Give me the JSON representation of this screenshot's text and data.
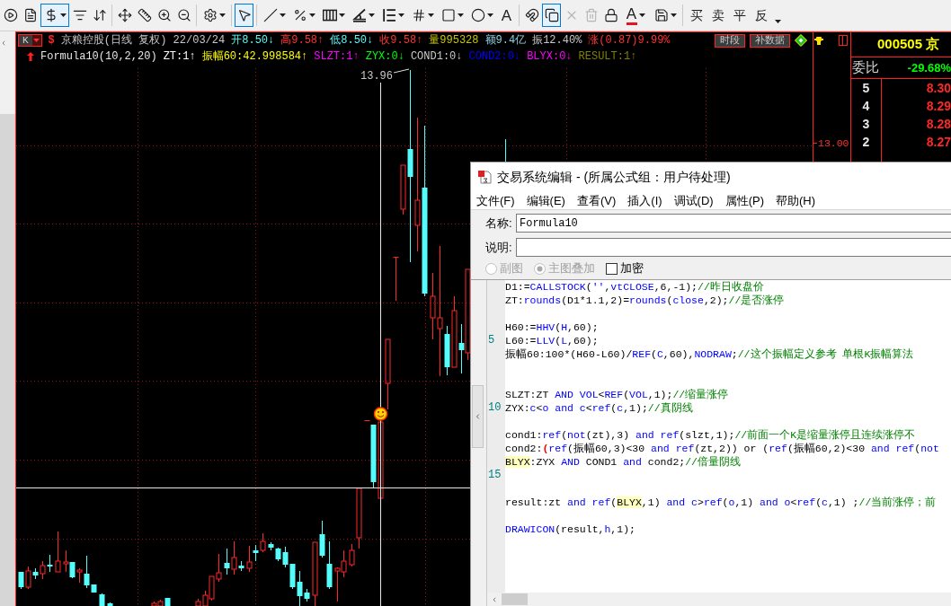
{
  "toolbar": {
    "groups": [
      {
        "tools": [
          {
            "kind": "icon",
            "selected": false,
            "disabled": false,
            "dropdown": false
          },
          {
            "kind": "icon",
            "selected": false,
            "disabled": false,
            "dropdown": false
          },
          {
            "kind": "icon",
            "selected": true,
            "disabled": false,
            "dropdown": true
          },
          {
            "kind": "icon",
            "selected": false,
            "disabled": false,
            "dropdown": false
          },
          {
            "kind": "icon",
            "selected": false,
            "disabled": false,
            "dropdown": false
          }
        ]
      },
      {
        "tools": [
          {
            "kind": "icon",
            "selected": false,
            "disabled": false,
            "dropdown": false
          },
          {
            "kind": "icon",
            "selected": false,
            "disabled": false,
            "dropdown": false
          },
          {
            "kind": "icon",
            "selected": false,
            "disabled": false,
            "dropdown": false
          },
          {
            "kind": "icon",
            "selected": false,
            "disabled": false,
            "dropdown": false
          }
        ]
      },
      {
        "tools": [
          {
            "kind": "icon",
            "selected": false,
            "disabled": false,
            "dropdown": true
          }
        ]
      },
      {
        "tools": [
          {
            "kind": "icon",
            "selected": true,
            "disabled": false,
            "dropdown": false
          }
        ]
      },
      {
        "tools": [
          {
            "kind": "icon",
            "selected": false,
            "disabled": false,
            "dropdown": true
          },
          {
            "kind": "icon",
            "selected": false,
            "disabled": false,
            "dropdown": true
          },
          {
            "kind": "icon",
            "selected": false,
            "disabled": false,
            "dropdown": true
          },
          {
            "kind": "icon",
            "selected": false,
            "disabled": false,
            "dropdown": true
          },
          {
            "kind": "icon",
            "selected": false,
            "disabled": false,
            "dropdown": true
          },
          {
            "kind": "icon",
            "selected": false,
            "disabled": false,
            "dropdown": true
          },
          {
            "kind": "icon",
            "selected": false,
            "disabled": false,
            "dropdown": true
          },
          {
            "kind": "icon",
            "selected": false,
            "disabled": false,
            "dropdown": true
          },
          {
            "kind": "text",
            "label": "A",
            "selected": false,
            "disabled": false,
            "dropdown": false
          }
        ]
      },
      {
        "tools": [
          {
            "kind": "icon",
            "selected": false,
            "disabled": false,
            "dropdown": false
          },
          {
            "kind": "icon",
            "selected": true,
            "disabled": false,
            "dropdown": false
          },
          {
            "kind": "icon",
            "selected": false,
            "disabled": true,
            "dropdown": false
          },
          {
            "kind": "icon",
            "selected": false,
            "disabled": true,
            "dropdown": false
          },
          {
            "kind": "icon",
            "selected": false,
            "disabled": false,
            "dropdown": false
          },
          {
            "kind": "font-color",
            "label": "A",
            "selected": false,
            "disabled": false,
            "dropdown": true
          },
          {
            "kind": "icon",
            "selected": false,
            "disabled": false,
            "dropdown": true
          }
        ]
      },
      {
        "tools": [
          {
            "kind": "trade",
            "label": "买",
            "selected": false,
            "disabled": false,
            "dropdown": false
          },
          {
            "kind": "trade",
            "label": "卖",
            "selected": false,
            "disabled": false,
            "dropdown": false
          },
          {
            "kind": "trade",
            "label": "平",
            "selected": false,
            "disabled": false,
            "dropdown": false
          },
          {
            "kind": "trade",
            "label": "反",
            "selected": false,
            "disabled": false,
            "dropdown": false
          },
          {
            "kind": "more",
            "selected": false,
            "disabled": false,
            "dropdown": true
          }
        ]
      }
    ]
  },
  "chart": {
    "period": "K",
    "symbol_mark": "$",
    "quote": [
      {
        "text": "京粮控股(日线 复权) 22/03/24",
        "color": "#c8c8c8"
      },
      {
        "text": "开8.50↓",
        "color": "#54fcfc"
      },
      {
        "text": "高9.58↑",
        "color": "#ff3232"
      },
      {
        "text": "低8.50↓",
        "color": "#54fcfc"
      },
      {
        "text": "收9.58↑",
        "color": "#ff3232"
      },
      {
        "text": "量995328",
        "color": "#c8c800"
      },
      {
        "text": "额9.4亿",
        "color": "#8cd2e6"
      },
      {
        "text": "振12.40%",
        "color": "#c8c8c8"
      },
      {
        "text": "涨(0.87)9.99%",
        "color": "#ff3232"
      }
    ],
    "buttons": [
      "时段",
      "补数据"
    ],
    "indicators": [
      {
        "text": "Formula10(10,2,20)",
        "color": "#e6e6e6"
      },
      {
        "text": "ZT:1↑",
        "color": "#ffffff"
      },
      {
        "text": "振幅60:42.998584↑",
        "color": "#ffff00"
      },
      {
        "text": "SLZT:1↑",
        "color": "#ff00ff"
      },
      {
        "text": "ZYX:0↓",
        "color": "#00ff00"
      },
      {
        "text": "COND1:0↓",
        "color": "#c8c8c8"
      },
      {
        "text": "COND2:0↓",
        "color": "#0000ff"
      },
      {
        "text": "BLYX:0↓",
        "color": "#ff00ff"
      },
      {
        "text": "RESULT:1↑",
        "color": "#808000"
      }
    ],
    "high_label": "13.96",
    "axis_label": "13.00"
  },
  "quote_panel": {
    "title": "000505 京",
    "ratio_label": "委比",
    "ratio_value": "-29.68%",
    "asks": [
      {
        "rank": "5",
        "price": "8.30"
      },
      {
        "rank": "4",
        "price": "8.29"
      },
      {
        "rank": "3",
        "price": "8.28"
      },
      {
        "rank": "2",
        "price": "8.27"
      }
    ]
  },
  "editor": {
    "title": "交易系统编辑 - (所属公式组：用户待处理)",
    "menu": [
      "文件(F)",
      "编辑(E)",
      "查看(V)",
      "插入(I)",
      "调试(D)",
      "属性(P)",
      "帮助(H)"
    ],
    "name_label": "名称:",
    "name_value": "Formula10",
    "description_label": "说明:",
    "chart_types": [
      {
        "label": "副图",
        "selected": false,
        "disabled": true
      },
      {
        "label": "主图叠加",
        "selected": true,
        "disabled": true
      }
    ],
    "encrypt": {
      "label": "加密",
      "checked": false
    },
    "code_lines": [
      {
        "kind": "code",
        "tokens": [
          {
            "text": "D1:=",
            "kind": "plain"
          },
          {
            "text": "CALLSTOCK",
            "kind": "keyword"
          },
          {
            "text": "(",
            "kind": "plain"
          },
          {
            "text": "''",
            "kind": "keyword"
          },
          {
            "text": ",",
            "kind": "plain"
          },
          {
            "text": "vtCLOSE",
            "kind": "keyword"
          },
          {
            "text": ",6,-1);",
            "kind": "plain"
          },
          {
            "text": "//昨日收盘价",
            "kind": "comment"
          }
        ]
      },
      {
        "kind": "code",
        "tokens": [
          {
            "text": "ZT:",
            "kind": "plain"
          },
          {
            "text": "rounds",
            "kind": "keyword"
          },
          {
            "text": "(D1*1.1,2)=",
            "kind": "plain"
          },
          {
            "text": "rounds",
            "kind": "keyword"
          },
          {
            "text": "(",
            "kind": "plain"
          },
          {
            "text": "close",
            "kind": "keyword"
          },
          {
            "text": ",2);",
            "kind": "plain"
          },
          {
            "text": "//是否涨停",
            "kind": "comment"
          }
        ]
      },
      {
        "kind": "blank"
      },
      {
        "kind": "code",
        "tokens": [
          {
            "text": "H60:=",
            "kind": "plain"
          },
          {
            "text": "HHV",
            "kind": "keyword"
          },
          {
            "text": "(",
            "kind": "plain"
          },
          {
            "text": "H",
            "kind": "keyword"
          },
          {
            "text": ",60);",
            "kind": "plain"
          }
        ]
      },
      {
        "kind": "code",
        "line_number": "5",
        "tokens": [
          {
            "text": "L60:=",
            "kind": "plain"
          },
          {
            "text": "LLV",
            "kind": "keyword"
          },
          {
            "text": "(",
            "kind": "plain"
          },
          {
            "text": "L",
            "kind": "keyword"
          },
          {
            "text": ",60);",
            "kind": "plain"
          }
        ]
      },
      {
        "kind": "code",
        "tokens": [
          {
            "text": "振幅60:100*(H60-L60)/",
            "kind": "plain"
          },
          {
            "text": "REF",
            "kind": "keyword"
          },
          {
            "text": "(",
            "kind": "plain"
          },
          {
            "text": "C",
            "kind": "keyword"
          },
          {
            "text": ",60),",
            "kind": "plain"
          },
          {
            "text": "NODRAW",
            "kind": "keyword"
          },
          {
            "text": ";",
            "kind": "plain"
          },
          {
            "text": "//这个振幅定义参考 单根K振幅算法",
            "kind": "comment"
          }
        ]
      },
      {
        "kind": "blank"
      },
      {
        "kind": "blank"
      },
      {
        "kind": "code",
        "tokens": [
          {
            "text": "SLZT:ZT ",
            "kind": "plain"
          },
          {
            "text": "AND ",
            "kind": "keyword"
          },
          {
            "text": "VOL",
            "kind": "keyword"
          },
          {
            "text": "<",
            "kind": "plain"
          },
          {
            "text": "REF",
            "kind": "keyword"
          },
          {
            "text": "(",
            "kind": "plain"
          },
          {
            "text": "VOL",
            "kind": "keyword"
          },
          {
            "text": ",1);",
            "kind": "plain"
          },
          {
            "text": "//缩量涨停",
            "kind": "comment"
          }
        ]
      },
      {
        "kind": "code",
        "line_number": "10",
        "tokens": [
          {
            "text": "ZYX:",
            "kind": "plain"
          },
          {
            "text": "c",
            "kind": "keyword"
          },
          {
            "text": "<",
            "kind": "plain"
          },
          {
            "text": "o and c",
            "kind": "keyword"
          },
          {
            "text": "<",
            "kind": "plain"
          },
          {
            "text": "ref",
            "kind": "keyword"
          },
          {
            "text": "(",
            "kind": "plain"
          },
          {
            "text": "c",
            "kind": "keyword"
          },
          {
            "text": ",1);",
            "kind": "plain"
          },
          {
            "text": "//真阴线",
            "kind": "comment"
          }
        ]
      },
      {
        "kind": "blank"
      },
      {
        "kind": "code",
        "tokens": [
          {
            "text": "cond1:",
            "kind": "plain"
          },
          {
            "text": "ref",
            "kind": "keyword"
          },
          {
            "text": "(",
            "kind": "plain"
          },
          {
            "text": "not",
            "kind": "keyword"
          },
          {
            "text": "(zt),3) ",
            "kind": "plain"
          },
          {
            "text": "and ref",
            "kind": "keyword"
          },
          {
            "text": "(slzt,1);",
            "kind": "plain"
          },
          {
            "text": "//前面一个K是缩量涨停且连续涨停不",
            "kind": "comment"
          }
        ]
      },
      {
        "kind": "code",
        "tokens": [
          {
            "text": "cond2:",
            "kind": "plain"
          },
          {
            "text": "(",
            "kind": "match"
          },
          {
            "text": "ref",
            "kind": "keyword"
          },
          {
            "text": "(振幅60,3)<30 ",
            "kind": "plain"
          },
          {
            "text": "and ref",
            "kind": "keyword"
          },
          {
            "text": "(zt,2)) or (",
            "kind": "plain"
          },
          {
            "text": "ref",
            "kind": "keyword"
          },
          {
            "text": "(振幅60,2)<30 ",
            "kind": "plain"
          },
          {
            "text": "and ref",
            "kind": "keyword"
          },
          {
            "text": "(",
            "kind": "plain"
          },
          {
            "text": "not",
            "kind": "keyword"
          }
        ]
      },
      {
        "kind": "code",
        "tokens": [
          {
            "text": "BLYX",
            "kind": "highlight"
          },
          {
            "text": ":ZYX ",
            "kind": "plain"
          },
          {
            "text": "AND",
            "kind": "keyword"
          },
          {
            "text": " COND1 ",
            "kind": "plain"
          },
          {
            "text": "and",
            "kind": "keyword"
          },
          {
            "text": " cond2;",
            "kind": "plain"
          },
          {
            "text": "//倍量阴线",
            "kind": "comment"
          }
        ]
      },
      {
        "kind": "blank",
        "line_number": "15"
      },
      {
        "kind": "blank"
      },
      {
        "kind": "code",
        "tokens": [
          {
            "text": "result:zt ",
            "kind": "plain"
          },
          {
            "text": "and ref",
            "kind": "keyword"
          },
          {
            "text": "(",
            "kind": "plain"
          },
          {
            "text": "BLYX",
            "kind": "highlight"
          },
          {
            "text": ",1) ",
            "kind": "plain"
          },
          {
            "text": "and c",
            "kind": "keyword"
          },
          {
            "text": ">",
            "kind": "plain"
          },
          {
            "text": "ref",
            "kind": "keyword"
          },
          {
            "text": "(",
            "kind": "plain"
          },
          {
            "text": "o",
            "kind": "keyword"
          },
          {
            "text": ",1) ",
            "kind": "plain"
          },
          {
            "text": "and o",
            "kind": "keyword"
          },
          {
            "text": "<",
            "kind": "plain"
          },
          {
            "text": "ref",
            "kind": "keyword"
          },
          {
            "text": "(",
            "kind": "plain"
          },
          {
            "text": "c",
            "kind": "keyword"
          },
          {
            "text": ",1) ;",
            "kind": "plain"
          },
          {
            "text": "//当前涨停；前",
            "kind": "comment"
          }
        ]
      },
      {
        "kind": "blank"
      },
      {
        "kind": "code",
        "tokens": [
          {
            "text": "DRAWICON",
            "kind": "keyword"
          },
          {
            "text": "(result,",
            "kind": "plain"
          },
          {
            "text": "h",
            "kind": "keyword"
          },
          {
            "text": ",1);",
            "kind": "plain"
          }
        ]
      }
    ]
  }
}
